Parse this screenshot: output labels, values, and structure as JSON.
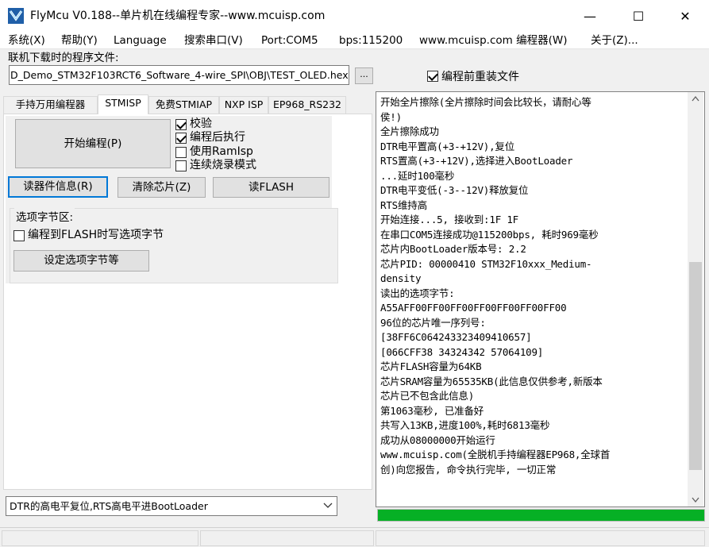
{
  "window": {
    "title": "FlyMcu V0.188--单片机在线编程专家--www.mcuisp.com",
    "minimize_glyph": "—",
    "maximize_glyph": "☐",
    "close_glyph": "✕"
  },
  "menu": [
    "系统(X)",
    "帮助(Y)",
    "Language",
    "搜索串口(V)",
    "Port:COM5",
    "bps:115200",
    "www.mcuisp.com 编程器(W)",
    "关于(Z)..."
  ],
  "file": {
    "label": "联机下载时的程序文件:",
    "path": "D_Demo_STM32F103RCT6_Software_4-wire_SPI\\OBJ\\TEST_OLED.hex",
    "browse_label": "...",
    "reload_label": "编程前重装文件",
    "reload_checked": true
  },
  "tabs": [
    "手持万用编程器",
    "STMISP",
    "免费STMIAP",
    "NXP ISP",
    "EP968_RS232"
  ],
  "active_tab": "STMISP",
  "stmisp": {
    "start_button": "开始编程(P)",
    "checks": [
      {
        "label": "校验",
        "checked": true
      },
      {
        "label": "编程后执行",
        "checked": true
      },
      {
        "label": "使用RamIsp",
        "checked": false
      },
      {
        "label": "连续烧录模式",
        "checked": false
      }
    ],
    "read_info_button": "读器件信息(R)",
    "erase_button": "清除芯片(Z)",
    "read_flash_button": "读FLASH",
    "option_group_title": "选项字节区:",
    "option_check_label": "编程到FLASH时写选项字节",
    "option_check_checked": false,
    "set_option_button": "设定选项字节等"
  },
  "reset_mode": "DTR的高电平复位,RTS高电平进BootLoader",
  "log": [
    "开始全片擦除(全片擦除时间会比较长，请耐心等",
    "侯!)",
    "全片擦除成功",
    "DTR电平置高(+3-+12V),复位",
    "RTS置高(+3-+12V),选择进入BootLoader",
    "...延时100毫秒",
    "DTR电平变低(-3--12V)释放复位",
    "RTS维持高",
    "开始连接...5, 接收到:1F 1F",
    "在串口COM5连接成功@115200bps, 耗时969毫秒",
    "芯片内BootLoader版本号: 2.2",
    "芯片PID: 00000410  STM32F10xxx_Medium-",
    "density",
    "读出的选项字节:",
    "A55AFF00FF00FF00FF00FF00FF00FF00",
    "96位的芯片唯一序列号:",
    "[38FF6C064243323409410657]",
    "[066CFF38 34324342 57064109]",
    "芯片FLASH容量为64KB",
    "芯片SRAM容量为65535KB(此信息仅供参考,新版本",
    "芯片已不包含此信息)",
    "第1063毫秒, 已准备好",
    "共写入13KB,进度100%,耗时6813毫秒",
    "成功从08000000开始运行",
    "www.mcuisp.com(全脱机手持编程器EP968,全球首",
    "创)向您报告, 命令执行完毕, 一切正常"
  ],
  "progress_fraction": 1.0,
  "colors": {
    "progress": "#06b025",
    "focus": "#0078d7"
  }
}
